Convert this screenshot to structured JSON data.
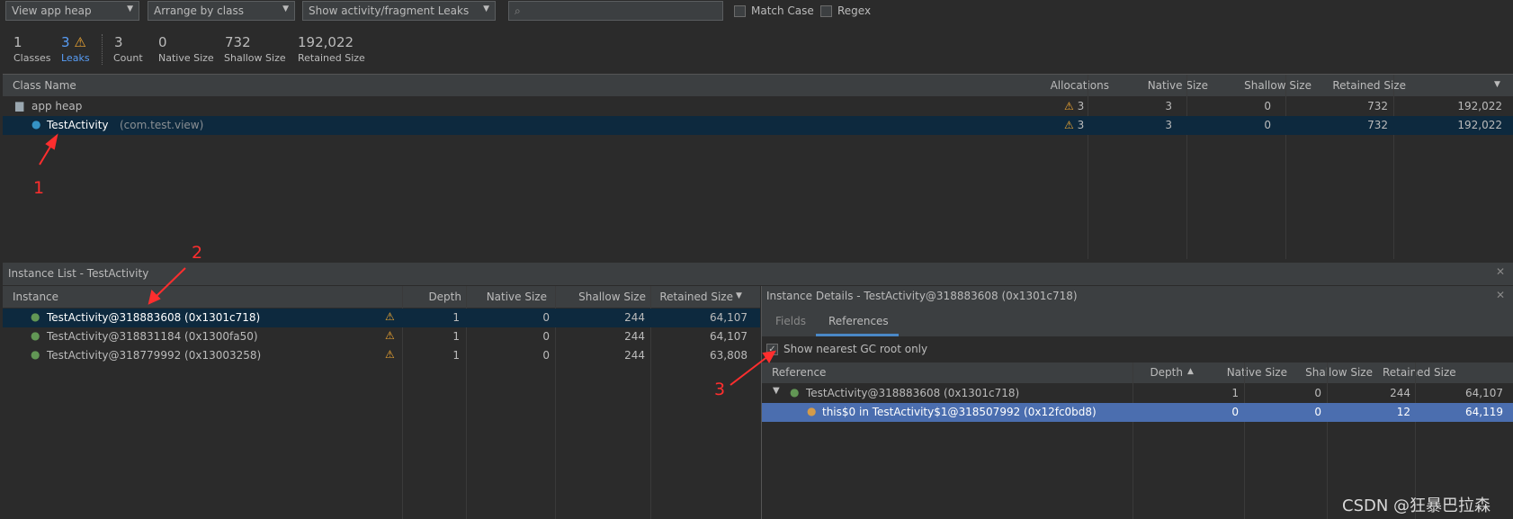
{
  "toolbar": {
    "heap": "View app heap",
    "arrange": "Arrange by class",
    "leaks": "Show activity/fragment Leaks",
    "match_case": "Match Case",
    "regex": "Regex"
  },
  "stats": [
    {
      "value": "1",
      "label": "Classes"
    },
    {
      "value": "3",
      "label": "Leaks"
    },
    {
      "value": "3",
      "label": "Count"
    },
    {
      "value": "0",
      "label": "Native Size"
    },
    {
      "value": "732",
      "label": "Shallow Size"
    },
    {
      "value": "192,022",
      "label": "Retained Size"
    }
  ],
  "class_table": {
    "headers": [
      "Class Name",
      "Allocations",
      "Native Size",
      "Shallow Size",
      "Retained Size"
    ],
    "rows": [
      {
        "name": "app heap",
        "pkg": "",
        "leaks": "3",
        "alloc": "3",
        "native": "0",
        "shallow": "732",
        "retained": "192,022"
      },
      {
        "name": "TestActivity",
        "pkg": "(com.test.view)",
        "leaks": "3",
        "alloc": "3",
        "native": "0",
        "shallow": "732",
        "retained": "192,022"
      }
    ]
  },
  "instance_list": {
    "title": "Instance List - TestActivity",
    "headers": [
      "Instance",
      "Depth",
      "Native Size",
      "Shallow Size",
      "Retained Size"
    ],
    "rows": [
      {
        "name": "TestActivity@318883608 (0x1301c718)",
        "depth": "1",
        "native": "0",
        "shallow": "244",
        "retained": "64,107"
      },
      {
        "name": "TestActivity@318831184 (0x1300fa50)",
        "depth": "1",
        "native": "0",
        "shallow": "244",
        "retained": "64,107"
      },
      {
        "name": "TestActivity@318779992 (0x13003258)",
        "depth": "1",
        "native": "0",
        "shallow": "244",
        "retained": "63,808"
      }
    ]
  },
  "details": {
    "title": "Instance Details - TestActivity@318883608 (0x1301c718)",
    "tabs": [
      "Fields",
      "References"
    ],
    "gc_label": "Show nearest GC root only",
    "headers": [
      "Reference",
      "Depth",
      "Native Size",
      "Shallow Size",
      "Retained Size"
    ],
    "rows": [
      {
        "name": "TestActivity@318883608 (0x1301c718)",
        "depth": "1",
        "native": "0",
        "shallow": "244",
        "retained": "64,107"
      },
      {
        "name": "this$0 in TestActivity$1@318507992 (0x12fc0bd8)",
        "depth": "0",
        "native": "0",
        "shallow": "12",
        "retained": "64,119"
      }
    ]
  },
  "annotations": [
    "1",
    "2",
    "3"
  ],
  "watermark": "CSDN @狂暴巴拉森"
}
